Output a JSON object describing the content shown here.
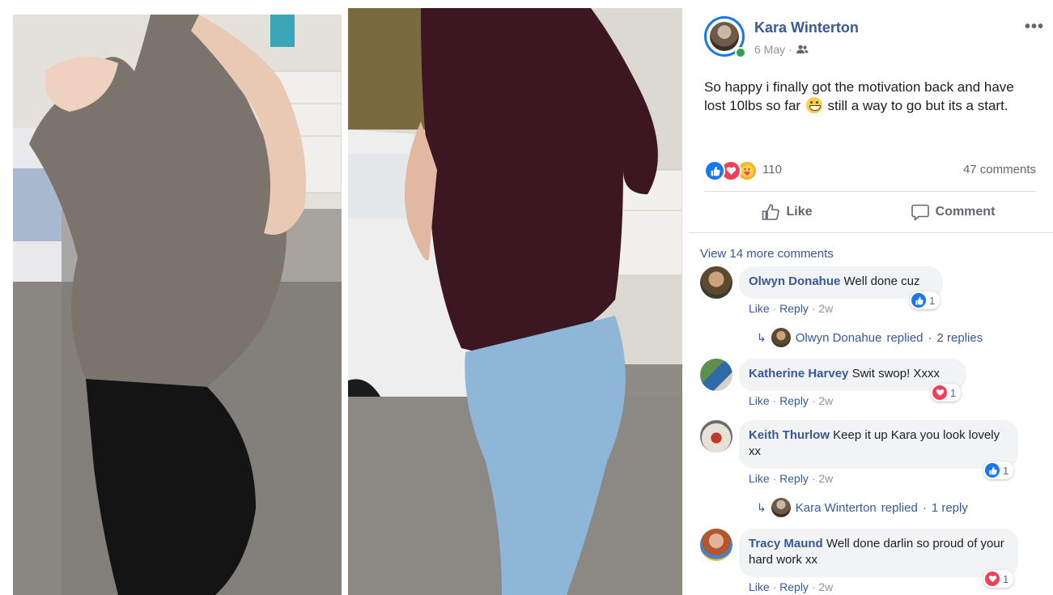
{
  "post": {
    "author": "Kara Winterton",
    "date": "6 May",
    "audience_icon": "friends-icon",
    "text_before_emoji": "So happy i finally got the motivation back and have lost 10lbs so far",
    "emoji": "grinning-face-icon",
    "text_after_emoji": "still a way to go but its a start.",
    "reactions_count": "110",
    "reaction_icons": [
      "like-icon",
      "love-icon",
      "care-icon"
    ],
    "comments_count": "47 comments",
    "like_label": "Like",
    "comment_label": "Comment",
    "options_label": "•••"
  },
  "comments": {
    "view_more": "View 14 more comments",
    "items": [
      {
        "name": "Olwyn Donahue",
        "text": "Well done cuz",
        "like": "Like",
        "reply": "Reply",
        "time": "2w",
        "reaction_icon": "like-icon",
        "reaction_count": "1",
        "replies": {
          "name": "Olwyn Donahue",
          "replied": "replied",
          "count": "2 replies"
        }
      },
      {
        "name": "Katherine Harvey",
        "text": "Swit swop! Xxxx",
        "like": "Like",
        "reply": "Reply",
        "time": "2w",
        "reaction_icon": "love-icon",
        "reaction_count": "1"
      },
      {
        "name": "Keith Thurlow",
        "text": "Keep it up Kara you look lovely xx",
        "like": "Like",
        "reply": "Reply",
        "time": "2w",
        "reaction_icon": "like-icon",
        "reaction_count": "1",
        "replies": {
          "name": "Kara Winterton",
          "replied": "replied",
          "count": "1 reply"
        }
      },
      {
        "name": "Tracy Maund",
        "text": "Well done darlin so proud of your hard work xx",
        "like": "Like",
        "reply": "Reply",
        "time": "2w",
        "reaction_icon": "love-icon",
        "reaction_count": "1"
      }
    ]
  },
  "colors": {
    "link_blue": "#385898",
    "like_blue": "#1877f2",
    "love_red": "#f33e58",
    "online_green": "#31a24c",
    "bubble_gray": "#f2f3f5"
  }
}
